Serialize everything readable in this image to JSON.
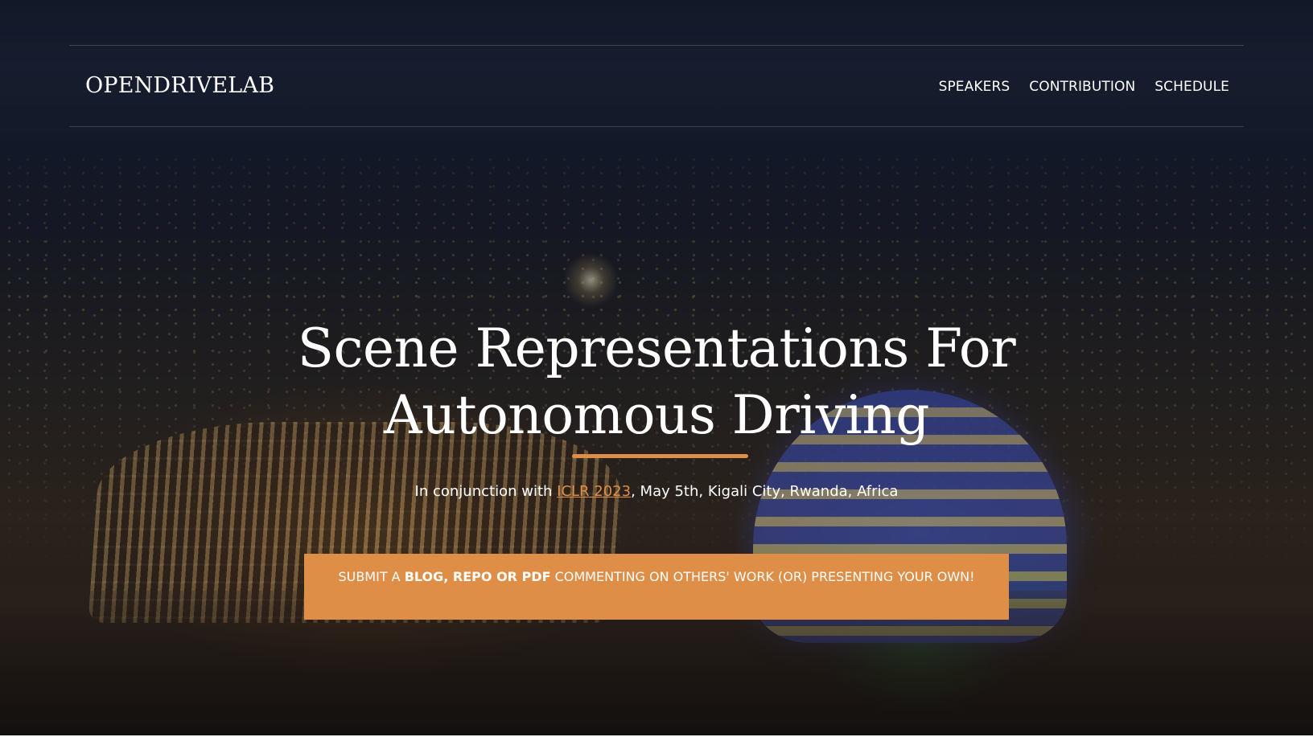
{
  "header": {
    "brand": "OPENDRIVELAB",
    "nav": [
      {
        "label": "SPEAKERS"
      },
      {
        "label": "CONTRIBUTION"
      },
      {
        "label": "SCHEDULE"
      }
    ]
  },
  "hero": {
    "title_line_1": "Scene Representations For",
    "title_line_2": "Autonomous Driving",
    "subtitle_prefix": "In conjunction with ",
    "event_link": "ICLR 2023",
    "subtitle_suffix": ", May 5th, Kigali City, Rwanda, Africa",
    "cta_prefix": "SUBMIT A ",
    "cta_bold": "BLOG, REPO OR PDF",
    "cta_suffix": " COMMENTING ON OTHERS' WORK (OR) PRESENTING YOUR OWN!"
  },
  "colors": {
    "accent": "#df8e47",
    "text": "#ffffff"
  }
}
